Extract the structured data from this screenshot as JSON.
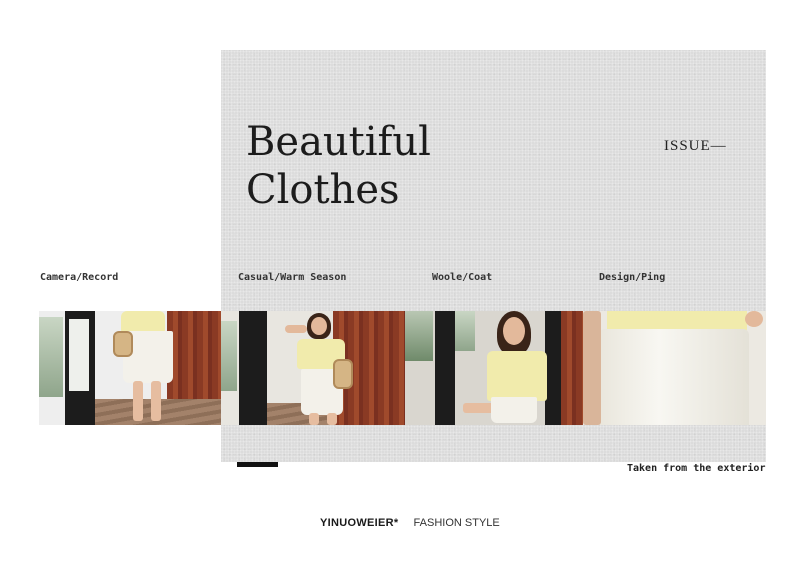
{
  "title": {
    "line1": "Beautiful",
    "line2": "Clothes"
  },
  "issue": "ISSUE—",
  "captions": [
    "Camera/Record",
    "Casual/Warm Season",
    "Woole/Coat",
    "Design/Ping"
  ],
  "footer_note": "Taken from the exterior",
  "brand": {
    "name": "YINUOWEIER*",
    "tagline": "FASHION STYLE"
  },
  "colors": {
    "panel": "#dcdcdc",
    "accent_black": "#111111",
    "top_yellow": "#f1ebac"
  }
}
